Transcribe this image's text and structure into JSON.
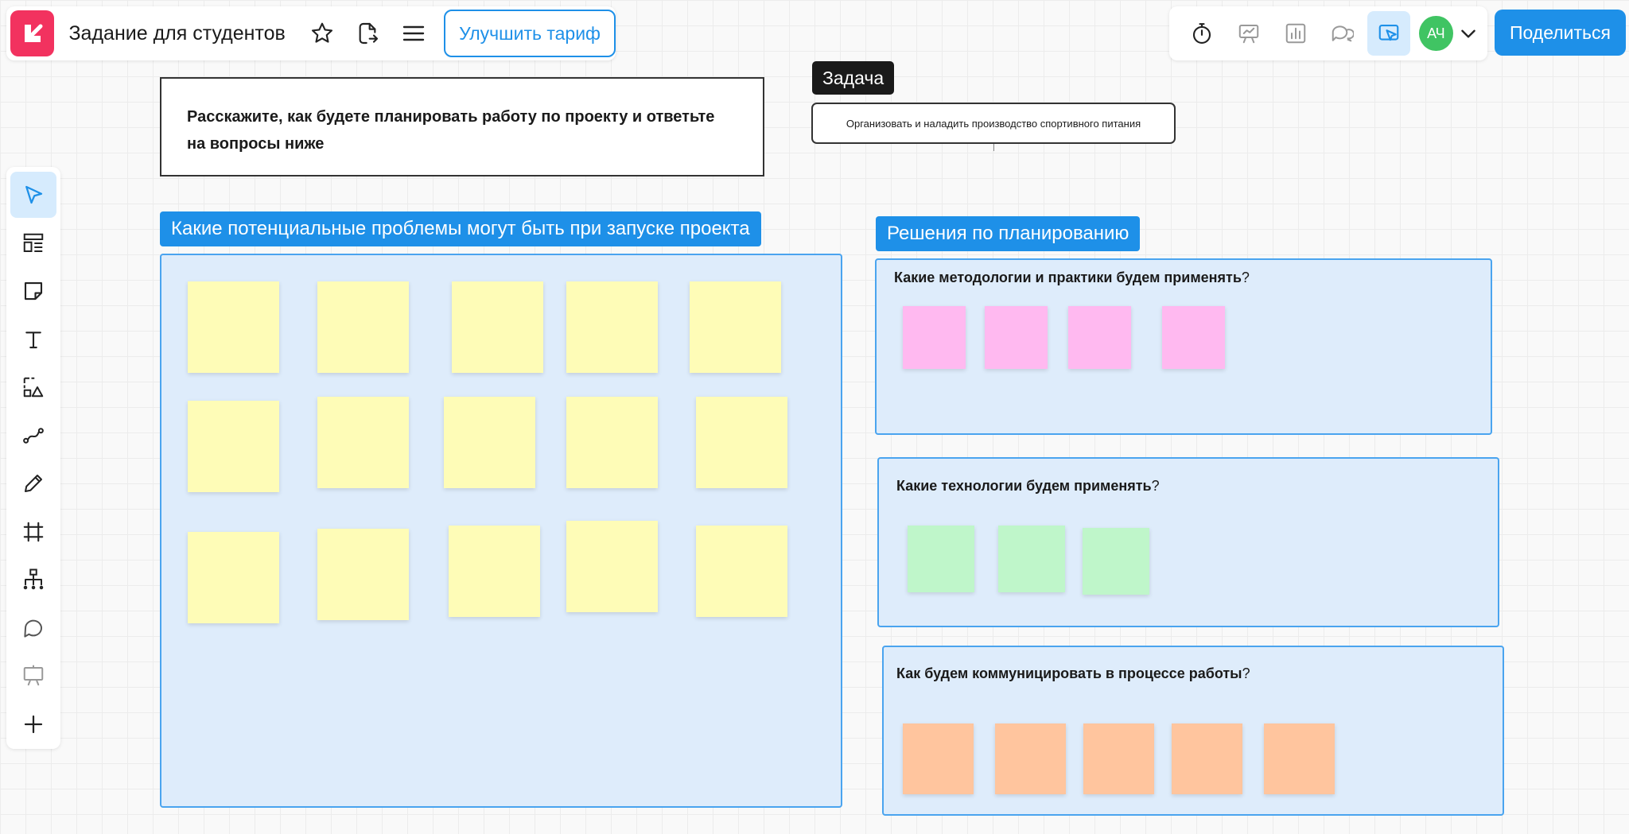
{
  "header": {
    "board_title": "Задание для студентов",
    "upgrade_label": "Улучшить тариф",
    "share_label": "Поделиться",
    "avatar_initials": "АЧ"
  },
  "colors": {
    "accent": "#1e90e8",
    "logo": "#f2325f",
    "frame_bg": "#deecfb",
    "sticky_yellow": "#fefcb7",
    "sticky_pink": "#ffb9f0",
    "sticky_green": "#bff6ca",
    "sticky_orange": "#ffc59e",
    "avatar": "#40c463"
  },
  "toolbar_right": {
    "icons": [
      "timer-icon",
      "presentation-icon",
      "chart-icon",
      "comments-icon",
      "follow-icon"
    ],
    "dropdown_icon": "chevron-down-icon"
  },
  "toolbar_left": {
    "tools": [
      "select-tool",
      "templates-tool",
      "sticky-note-tool",
      "text-tool",
      "shapes-tool",
      "connector-tool",
      "pen-tool",
      "frame-tool",
      "mindmap-tool",
      "comment-tool",
      "presentation-tool",
      "more-tools"
    ]
  },
  "board": {
    "prompt_text": "Расскажите, как будете планировать работу по проекту и ответьте на вопросы ниже",
    "task_label": "Задача",
    "task_text": "Организовать и наладить производство спортивного питания",
    "problems_header": "Какие потенциальные проблемы могут быть при запуске проекта",
    "solutions_header": "Решения по планированию",
    "methodologies_question": "Какие методологии и практики будем применять",
    "technologies_question": "Какие технологии будем применять",
    "communication_question": "Как будем коммуницировать в процессе работы",
    "question_mark": "?"
  }
}
